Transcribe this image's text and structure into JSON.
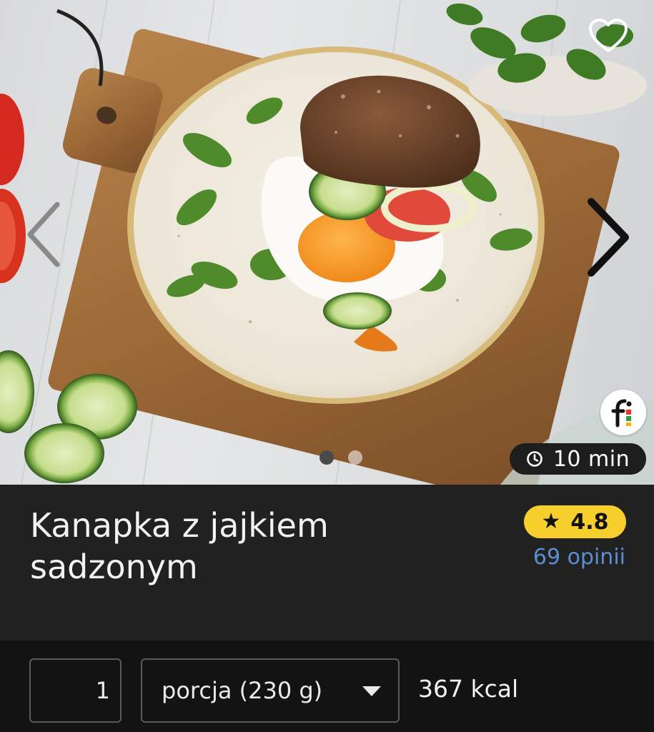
{
  "hero": {
    "image_alt": "Kanapka z jajkiem sadzonym na talerzu",
    "favorite_icon": "heart-outline-icon",
    "prev_icon": "chevron-left-icon",
    "next_icon": "chevron-right-icon",
    "logo_icon": "fitatu-logo-icon",
    "carousel": {
      "total": 2,
      "active_index": 0
    },
    "time": {
      "icon": "clock-icon",
      "value": "10 min"
    }
  },
  "recipe": {
    "title": "Kanapka z jajkiem sadzonym",
    "rating": {
      "icon": "star-icon",
      "value": "4.8",
      "color": "#f6cf2c"
    },
    "reviews_label": "69 opinii",
    "reviews_color": "#5b8fd0"
  },
  "serving": {
    "quantity": "1",
    "unit_selected": "porcja (230 g)",
    "unit_icon": "caret-down-icon",
    "kcal": "367 kcal"
  }
}
